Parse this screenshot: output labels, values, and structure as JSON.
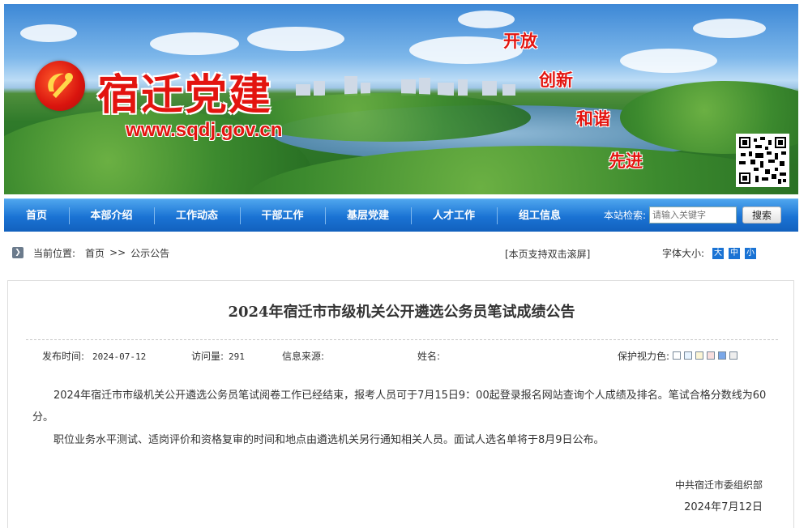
{
  "banner": {
    "site_name": "宿迁党建",
    "site_url": "www.sqdj.gov.cn",
    "slogans": [
      "开放",
      "创新",
      "和谐",
      "先进"
    ],
    "emblem_icon": "party-emblem-icon",
    "qr_icon": "qr-code-icon",
    "brand_color": "#e3140f"
  },
  "nav": {
    "items": [
      "首页",
      "本部介绍",
      "工作动态",
      "干部工作",
      "基层党建",
      "人才工作",
      "组工信息"
    ],
    "search_label": "本站检索:",
    "search_placeholder": "请输入关键字",
    "search_button": "搜索",
    "color": "#1a73d4"
  },
  "breadcrumb": {
    "label": "当前位置:",
    "items": [
      "首页",
      "公示公告"
    ],
    "separator": ">>"
  },
  "dblclick_hint": "[本页支持双击滚屏]",
  "font_size": {
    "label": "字体大小:",
    "options": [
      "大",
      "中",
      "小"
    ]
  },
  "article": {
    "title": "2024年宿迁市市级机关公开遴选公务员笔试成绩公告",
    "meta": {
      "publish_label": "发布时间:",
      "publish_date": "2024-07-12",
      "visits_label": "访问量:",
      "visits": "291",
      "source_label": "信息来源:",
      "source": "",
      "author_label": "姓名:",
      "author": ""
    },
    "eye_label": "保护视力色:",
    "eye_colors": [
      "#ffffff",
      "#e6f3ff",
      "#fcf5d5",
      "#f9dede",
      "#7aa7e8",
      "#eeeeee"
    ],
    "paragraphs": [
      "2024年宿迁市市级机关公开遴选公务员笔试阅卷工作已经结束，报考人员可于7月15日9：00起登录报名网站查询个人成绩及排名。笔试合格分数线为60分。",
      "职位业务水平测试、适岗评价和资格复审的时间和地点由遴选机关另行通知相关人员。面试人选名单将于8月9日公布。"
    ],
    "signature": "中共宿迁市委组织部",
    "date": "2024年7月12日"
  }
}
